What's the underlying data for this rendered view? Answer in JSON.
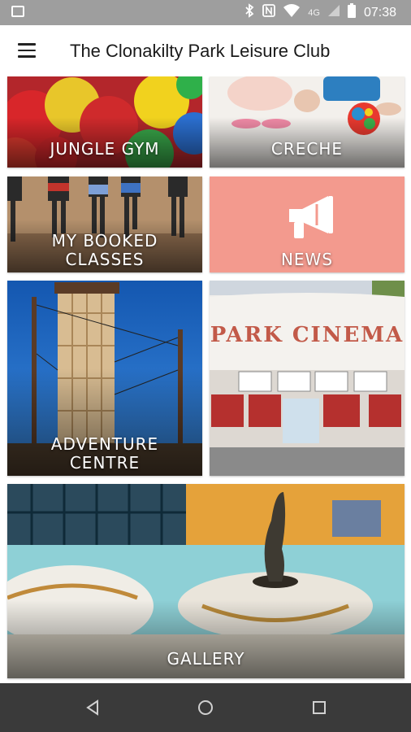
{
  "status_bar": {
    "time": "07:38",
    "network": "4G"
  },
  "app_bar": {
    "title": "The Clonakilty Park Leisure Club"
  },
  "tiles": {
    "jungle_gym": "JUNGLE GYM",
    "creche": "CRECHE",
    "my_booked_classes_line1": "MY BOOKED",
    "my_booked_classes_line2": "CLASSES",
    "news": "NEWS",
    "adventure_centre_line1": "ADVENTURE",
    "adventure_centre_line2": "CENTRE",
    "park_cinema_sign": "PARK CINEMA",
    "gallery": "GALLERY"
  },
  "colors": {
    "news_tile": "#f39a8e",
    "status_bar": "#9e9e9e",
    "nav_bar": "#3a3a3a"
  },
  "icons": [
    "image-icon",
    "bluetooth-icon",
    "nfc-icon",
    "wifi-icon",
    "signal-icon",
    "battery-icon",
    "menu-icon",
    "megaphone-icon",
    "back-icon",
    "home-icon",
    "recents-icon"
  ]
}
